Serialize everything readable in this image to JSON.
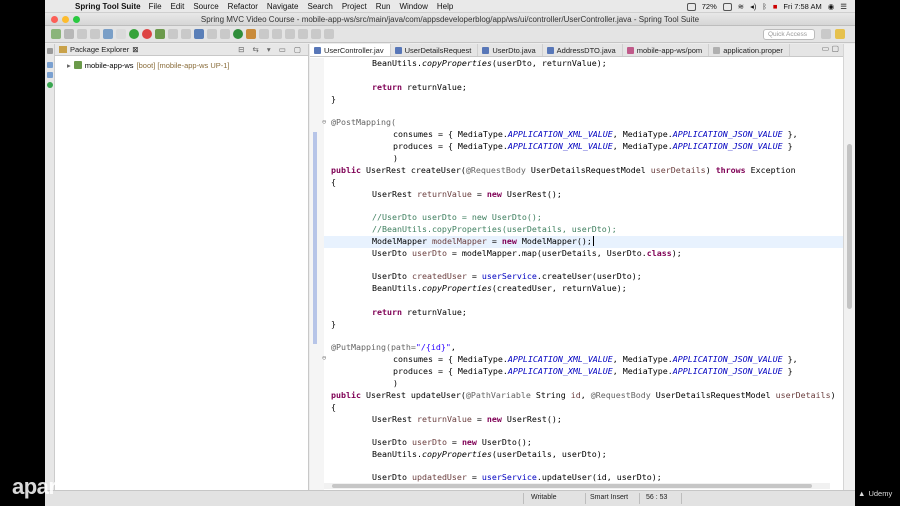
{
  "menubar": {
    "app_name": "Spring Tool Suite",
    "items": [
      "File",
      "Edit",
      "Source",
      "Refactor",
      "Navigate",
      "Search",
      "Project",
      "Run",
      "Window",
      "Help"
    ],
    "battery": "72%",
    "clock": "Fri 7:58 AM"
  },
  "window": {
    "title": "Spring MVC Video Course - mobile-app-ws/src/main/java/com/appsdeveloperblog/app/ws/ui/controller/UserController.java - Spring Tool Suite"
  },
  "toolbar": {
    "quick_access_placeholder": "Quick Access"
  },
  "package_explorer": {
    "title": "Package Explorer",
    "project": "mobile-app-ws",
    "project_decoration": "[boot] [mobile-app-ws UP-1]"
  },
  "editor": {
    "tabs": [
      {
        "label": "UserController.jav",
        "active": true
      },
      {
        "label": "UserDetailsRequest",
        "active": false
      },
      {
        "label": "UserDto.java",
        "active": false
      },
      {
        "label": "AddressDTO.java",
        "active": false
      },
      {
        "label": "mobile-app-ws/pom",
        "active": false
      },
      {
        "label": "application.proper",
        "active": false
      }
    ],
    "code": {
      "l1_a": "BeanUtils.",
      "l1_b": "copyProperties",
      "l1_c": "(userDto, returnValue);",
      "l2_kw": "return",
      "l2_rest": " returnValue;",
      "l3": "}",
      "l4": "@PostMapping(",
      "l5_a": "consumes = { MediaType.",
      "l5_b": "APPLICATION_XML_VALUE",
      "l5_c": ", MediaType.",
      "l5_d": "APPLICATION_JSON_VALUE",
      "l5_e": " },",
      "l6_a": "produces = { MediaType.",
      "l6_b": "APPLICATION_XML_VALUE",
      "l6_c": ", MediaType.",
      "l6_d": "APPLICATION_JSON_VALUE",
      "l6_e": " }",
      "l7": ")",
      "l8_kw": "public",
      "l8_a": " UserRest createUser(",
      "l8_an": "@RequestBody",
      "l8_b": " UserDetailsRequestModel ",
      "l8_var": "userDetails",
      "l8_c": ") ",
      "l8_kw2": "throws",
      "l8_d": " Exception",
      "l9": "{",
      "l10_a": "UserRest ",
      "l10_var": "returnValue",
      "l10_b": " = ",
      "l10_kw": "new",
      "l10_c": " UserRest();",
      "l11": "//UserDto userDto = new UserDto();",
      "l12": "//BeanUtils.copyProperties(userDetails, userDto);",
      "l13_a": "ModelMapper ",
      "l13_var": "modelMapper",
      "l13_b": " = ",
      "l13_kw": "new",
      "l13_c": " ModelMapper();",
      "l14_a": "UserDto ",
      "l14_var": "userDto",
      "l14_b": " = modelMapper.map(userDetails, UserDto.",
      "l14_kw": "class",
      "l14_c": ");",
      "l15_a": "UserDto ",
      "l15_var": "createdUser",
      "l15_b": " = ",
      "l15_fld": "userService",
      "l15_c": ".createUser(userDto);",
      "l16_a": "BeanUtils.",
      "l16_b": "copyProperties",
      "l16_c": "(createdUser, returnValue);",
      "l17_kw": "return",
      "l17_rest": " returnValue;",
      "l18": "}",
      "l19_a": "@PutMapping(path=",
      "l19_str": "\"/{id}\"",
      "l19_b": ",",
      "l20_a": "consumes = { MediaType.",
      "l20_b": "APPLICATION_XML_VALUE",
      "l20_c": ", MediaType.",
      "l20_d": "APPLICATION_JSON_VALUE",
      "l20_e": " },",
      "l21_a": "produces = { MediaType.",
      "l21_b": "APPLICATION_XML_VALUE",
      "l21_c": ", MediaType.",
      "l21_d": "APPLICATION_JSON_VALUE",
      "l21_e": " }",
      "l22": ")",
      "l23_kw": "public",
      "l23_a": " UserRest updateUser(",
      "l23_an": "@PathVariable",
      "l23_b": " String ",
      "l23_var": "id",
      "l23_c": ", ",
      "l23_an2": "@RequestBody",
      "l23_d": " UserDetailsRequestModel ",
      "l23_var2": "userDetails",
      "l23_e": ")",
      "l24": "{",
      "l25_a": "UserRest ",
      "l25_var": "returnValue",
      "l25_b": " = ",
      "l25_kw": "new",
      "l25_c": " UserRest();",
      "l26_a": "UserDto ",
      "l26_var": "userDto",
      "l26_b": " = ",
      "l26_kw": "new",
      "l26_c": " UserDto();",
      "l27_a": "BeanUtils.",
      "l27_b": "copyProperties",
      "l27_c": "(userDetails, userDto);",
      "l28_a": "UserDto ",
      "l28_var": "updatedUser",
      "l28_b": " = ",
      "l28_fld": "userService",
      "l28_c": ".updateUser(id, userDto);"
    }
  },
  "status": {
    "mode": "Writable",
    "insert": "Smart Insert",
    "position": "56 : 53"
  },
  "overlay": {
    "watermark": "apar",
    "udemy": "Udemy"
  }
}
